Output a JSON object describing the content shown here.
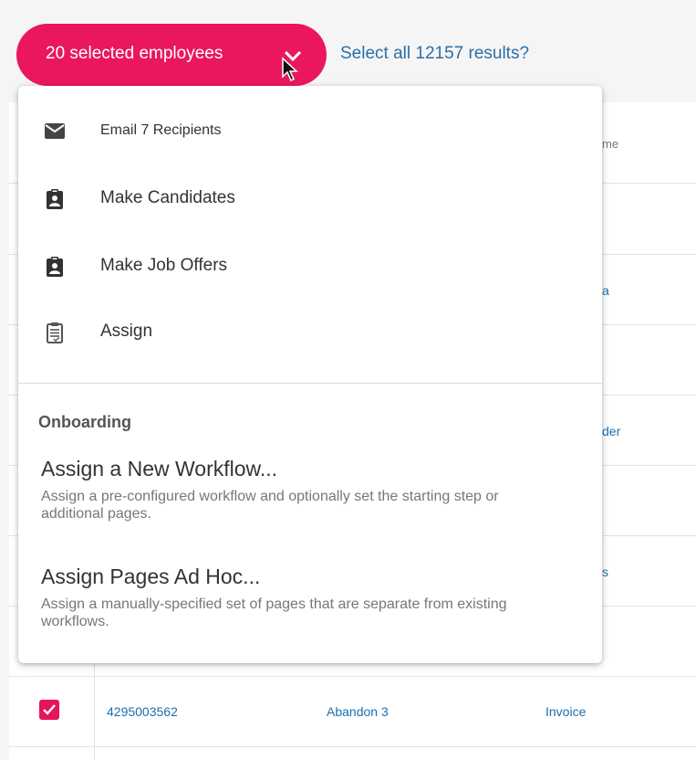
{
  "selection": {
    "label": "20 selected employees",
    "select_all": "Select all 12157 results?"
  },
  "menu": {
    "items": [
      {
        "label": "Email 7 Recipients",
        "icon": "mail-icon"
      },
      {
        "label": "Make Candidates",
        "icon": "clipboard-person-icon"
      },
      {
        "label": "Make Job Offers",
        "icon": "clipboard-person-icon"
      },
      {
        "label": "Assign",
        "icon": "clipboard-list-icon"
      }
    ],
    "section_title": "Onboarding",
    "workflows": [
      {
        "title": "Assign a New Workflow...",
        "desc": "Assign a pre-configured workflow and optionally set the starting step or additional pages."
      },
      {
        "title": "Assign Pages Ad Hoc...",
        "desc": "Assign a manually-specified set of pages that are separate from existing workflows."
      }
    ]
  },
  "table_peek": {
    "header": "me",
    "rows": [
      "a",
      "der",
      "s"
    ]
  },
  "visible_row": {
    "id": "4295003562",
    "name": "Abandon 3",
    "type": "Invoice",
    "checked": true
  },
  "colors": {
    "accent": "#ea175e",
    "link": "#1a6fb0"
  }
}
